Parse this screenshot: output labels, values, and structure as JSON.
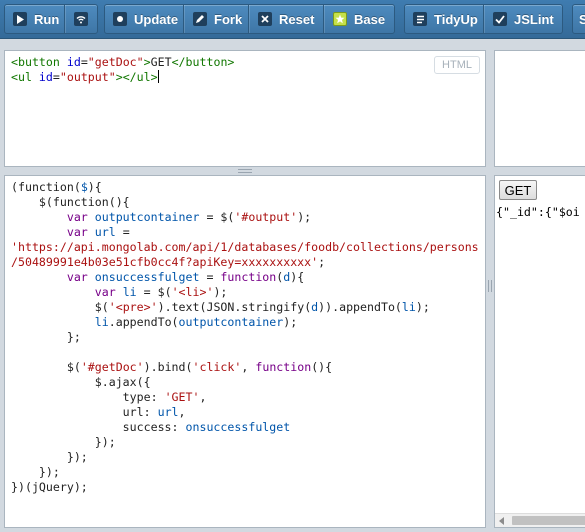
{
  "toolbar": {
    "run_label": "Run",
    "update_label": "Update",
    "fork_label": "Fork",
    "reset_label": "Reset",
    "base_label": "Base",
    "tidyup_label": "TidyUp",
    "jslint_label": "JSLint",
    "cut_label": "S"
  },
  "html_panel": {
    "label": "HTML",
    "lines": [
      [
        [
          "tag",
          "<button "
        ],
        [
          "attr",
          "id"
        ],
        [
          "p",
          "="
        ],
        [
          "str",
          "\"getDoc\""
        ],
        [
          "tag",
          ">"
        ],
        [
          "p",
          "GET"
        ],
        [
          "tag",
          "</button>"
        ]
      ],
      [
        [
          "tag",
          "<ul "
        ],
        [
          "attr",
          "id"
        ],
        [
          "p",
          "="
        ],
        [
          "str",
          "\"output\""
        ],
        [
          "tag",
          "></ul>"
        ],
        [
          "cursor",
          ""
        ]
      ]
    ]
  },
  "js_panel": {
    "lines": [
      [
        [
          "p",
          "(function("
        ],
        [
          "vr",
          "$"
        ],
        [
          "p",
          "){"
        ]
      ],
      [
        [
          "p",
          "    $(function(){"
        ]
      ],
      [
        [
          "p",
          "        "
        ],
        [
          "kw",
          "var "
        ],
        [
          "vr",
          "outputcontainer"
        ],
        [
          "p",
          " = $("
        ],
        [
          "str",
          "'#output'"
        ],
        [
          "p",
          ");"
        ]
      ],
      [
        [
          "p",
          "        "
        ],
        [
          "kw",
          "var "
        ],
        [
          "vr",
          "url"
        ],
        [
          "p",
          " ="
        ]
      ],
      [
        [
          "str",
          "'https://api.mongolab.com/api/1/databases/foodb/collections/persons"
        ]
      ],
      [
        [
          "str",
          "/50489991e4b03e51cfb0cc4f?apiKey=xxxxxxxxxx'"
        ],
        [
          "p",
          ";"
        ]
      ],
      [
        [
          "p",
          "        "
        ],
        [
          "kw",
          "var "
        ],
        [
          "vr",
          "onsuccessfulget"
        ],
        [
          "p",
          " = "
        ],
        [
          "kw",
          "function"
        ],
        [
          "p",
          "("
        ],
        [
          "vr",
          "d"
        ],
        [
          "p",
          "){"
        ]
      ],
      [
        [
          "p",
          "            "
        ],
        [
          "kw",
          "var "
        ],
        [
          "vr",
          "li"
        ],
        [
          "p",
          " = $("
        ],
        [
          "str",
          "'<li>'"
        ],
        [
          "p",
          ");"
        ]
      ],
      [
        [
          "p",
          "            $("
        ],
        [
          "str",
          "'<pre>'"
        ],
        [
          "p",
          ").text(JSON.stringify("
        ],
        [
          "vr",
          "d"
        ],
        [
          "p",
          ")).appendTo("
        ],
        [
          "vr",
          "li"
        ],
        [
          "p",
          ");"
        ]
      ],
      [
        [
          "p",
          "            "
        ],
        [
          "vr",
          "li"
        ],
        [
          "p",
          ".appendTo("
        ],
        [
          "vr",
          "outputcontainer"
        ],
        [
          "p",
          ");"
        ]
      ],
      [
        [
          "p",
          "        };"
        ]
      ],
      [
        [
          "p",
          ""
        ]
      ],
      [
        [
          "p",
          "        $("
        ],
        [
          "str",
          "'#getDoc'"
        ],
        [
          "p",
          ").bind("
        ],
        [
          "str",
          "'click'"
        ],
        [
          "p",
          ", "
        ],
        [
          "kw",
          "function"
        ],
        [
          "p",
          "(){"
        ]
      ],
      [
        [
          "p",
          "            $.ajax({"
        ]
      ],
      [
        [
          "p",
          "                type: "
        ],
        [
          "str",
          "'GET'"
        ],
        [
          "p",
          ","
        ]
      ],
      [
        [
          "p",
          "                url: "
        ],
        [
          "vr",
          "url"
        ],
        [
          "p",
          ","
        ]
      ],
      [
        [
          "p",
          "                success: "
        ],
        [
          "vr",
          "onsuccessfulget"
        ]
      ],
      [
        [
          "p",
          "            });"
        ]
      ],
      [
        [
          "p",
          "        });"
        ]
      ],
      [
        [
          "p",
          "    });"
        ]
      ],
      [
        [
          "p",
          "})(jQuery);"
        ]
      ]
    ]
  },
  "result": {
    "button_label": "GET",
    "output_text": "{\"_id\":{\"$oi"
  },
  "colors": {
    "toolbar": "#3f7cb0",
    "tag": "#117700",
    "attr": "#0000cc",
    "string": "#aa1111",
    "keyword": "#770088",
    "variable": "#0055aa"
  },
  "icons": [
    "play-icon",
    "wifi-icon",
    "update-icon",
    "pencil-icon",
    "close-icon",
    "star-icon",
    "lines-icon",
    "check-icon"
  ]
}
